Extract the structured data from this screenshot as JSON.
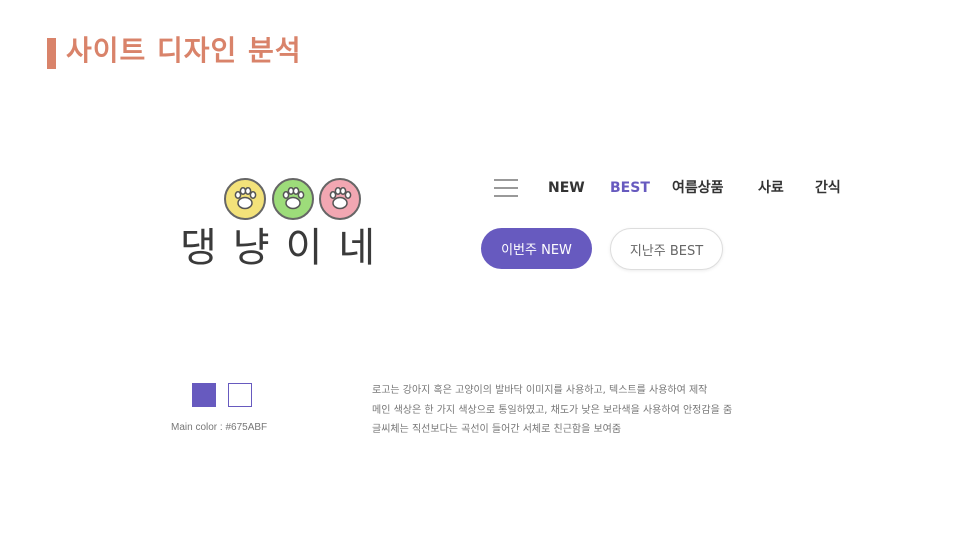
{
  "slide": {
    "title": "사이트 디자인 분석",
    "accent_color": "#D9836A"
  },
  "logo": {
    "paw_icons": [
      {
        "icon": "paw-icon",
        "color": "#F3E27A"
      },
      {
        "icon": "paw-icon",
        "color": "#9DDC7A"
      },
      {
        "icon": "paw-icon",
        "color": "#F2A7B2"
      }
    ],
    "text": "댕냥이네"
  },
  "nav": {
    "menu_icon": "hamburger-icon",
    "items": [
      {
        "label": "NEW",
        "active": false
      },
      {
        "label": "BEST",
        "active": true
      },
      {
        "label": "여름상품",
        "active": false
      },
      {
        "label": "사료",
        "active": false
      },
      {
        "label": "간식",
        "active": false
      }
    ],
    "active_color": "#675ABF"
  },
  "buttons": {
    "primary_label": "이번주 NEW",
    "secondary_label": "지난주 BEST"
  },
  "palette": {
    "main_color": "#675ABF",
    "secondary_color": "#FFFFFF",
    "label": "Main color : #675ABF"
  },
  "description": {
    "lines": [
      "로고는 강아지 혹은 고양이의 발바닥 이미지를 사용하고, 텍스트를 사용하여 제작",
      "메인 색상은 한 가지 색상으로 통일하였고, 채도가 낮은 보라색을 사용하여 안정감을 줌",
      "글씨체는 직선보다는 곡선이 들어간 서체로 친근함을 보여줌"
    ]
  }
}
